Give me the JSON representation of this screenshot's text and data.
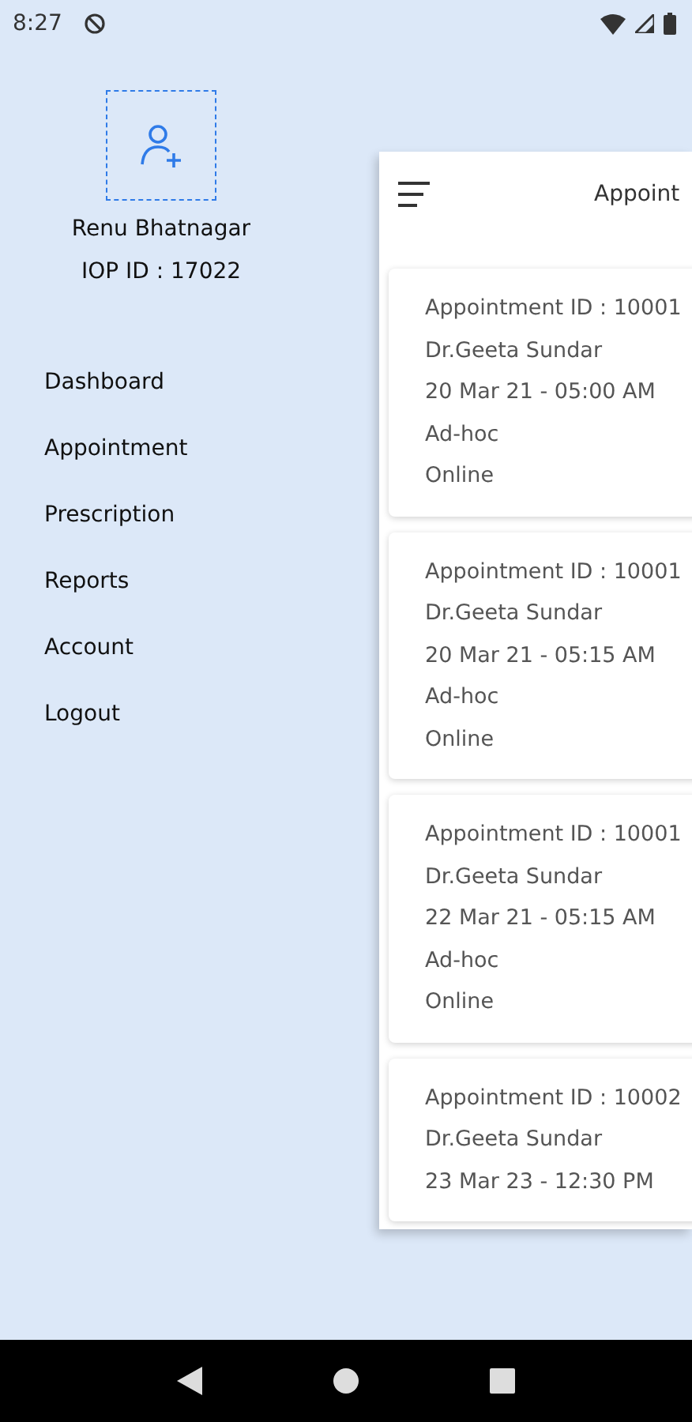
{
  "status_bar": {
    "time": "8:27"
  },
  "profile": {
    "name": "Renu Bhatnagar",
    "iop_id": "IOP ID : 17022"
  },
  "drawer": {
    "items": [
      {
        "label": "Dashboard"
      },
      {
        "label": "Appointment"
      },
      {
        "label": "Prescription"
      },
      {
        "label": "Reports"
      },
      {
        "label": "Account"
      },
      {
        "label": "Logout"
      }
    ]
  },
  "screen": {
    "title": "Appoint"
  },
  "appointments": [
    {
      "id": "Appointment ID : 10001",
      "doctor": "Dr.Geeta Sundar",
      "datetime": "20 Mar 21 - 05:00 AM",
      "type": "Ad-hoc",
      "mode": "Online"
    },
    {
      "id": "Appointment ID : 10001",
      "doctor": "Dr.Geeta Sundar",
      "datetime": "20 Mar 21 - 05:15 AM",
      "type": "Ad-hoc",
      "mode": "Online"
    },
    {
      "id": "Appointment ID : 10001",
      "doctor": "Dr.Geeta Sundar",
      "datetime": "22 Mar 21 - 05:15 AM",
      "type": "Ad-hoc",
      "mode": "Online"
    },
    {
      "id": "Appointment ID : 10002",
      "doctor": "Dr.Geeta Sundar",
      "datetime": "23 Mar 23 - 12:30 PM"
    }
  ]
}
